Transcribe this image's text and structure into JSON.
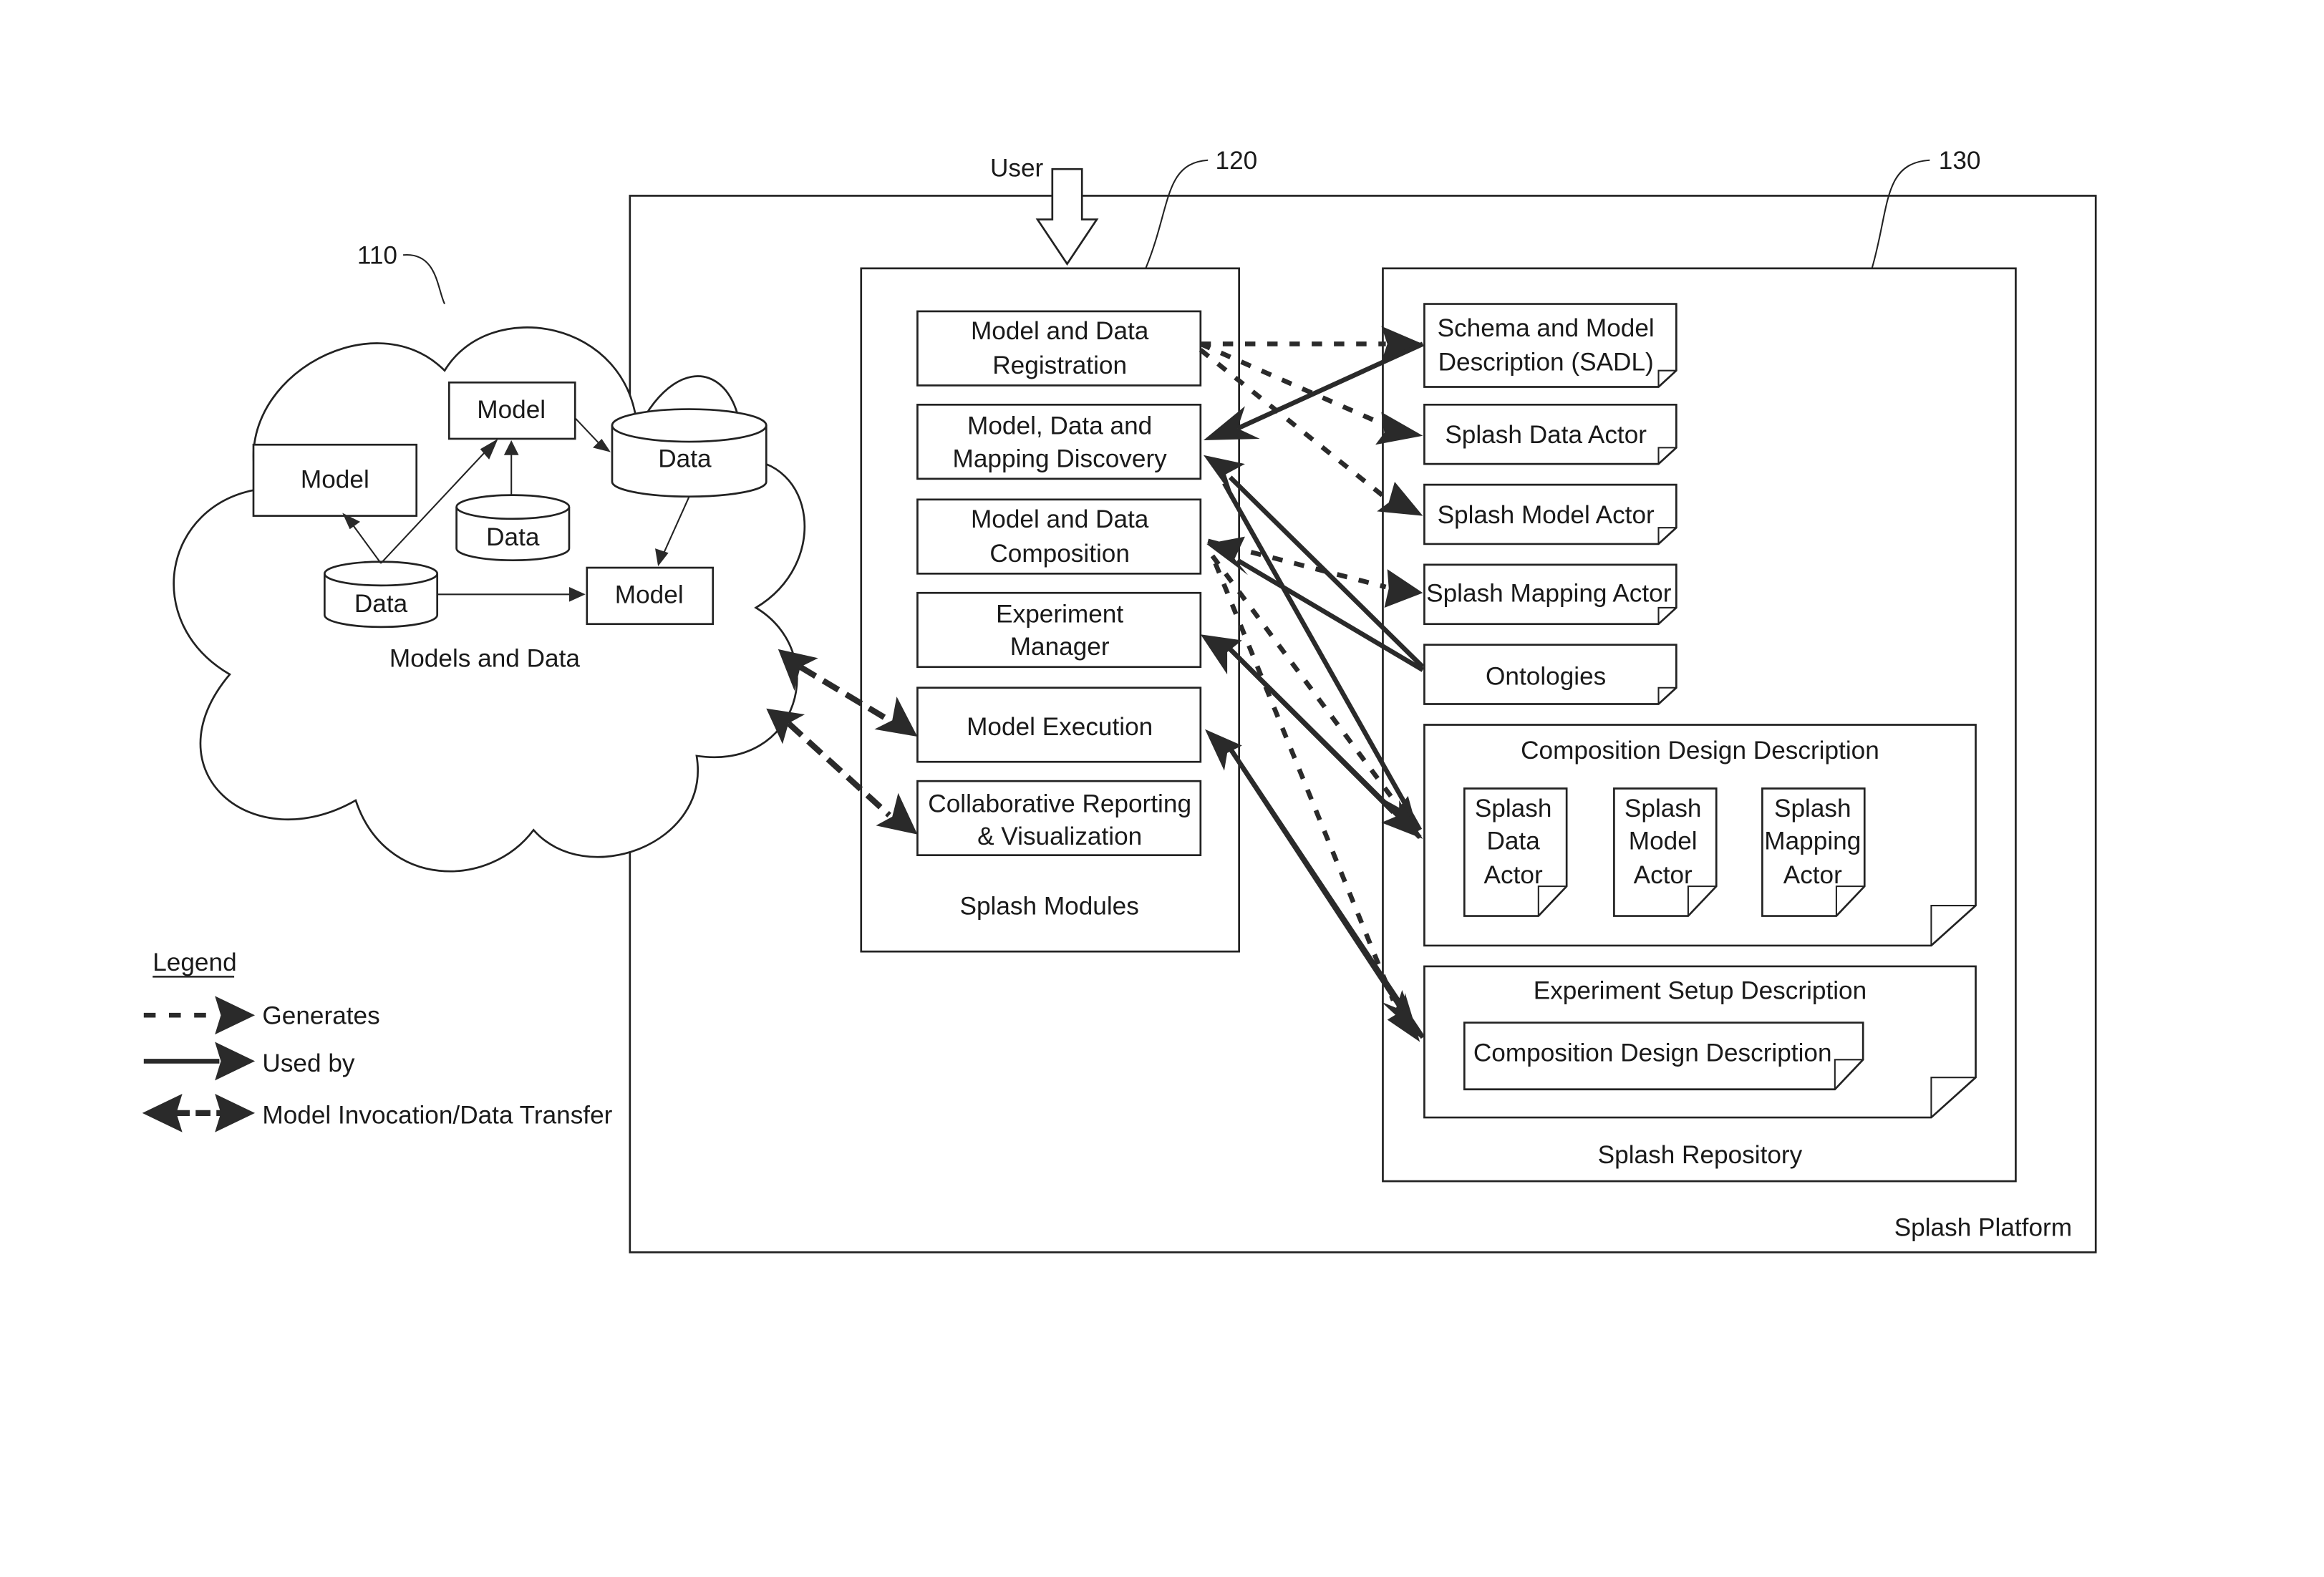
{
  "ref_labels": {
    "cloud": "110",
    "modules": "120",
    "repository": "130"
  },
  "user_label": "User",
  "cloud": {
    "title": "Models and Data",
    "nodes": [
      {
        "type": "model",
        "label": "Model"
      },
      {
        "type": "model",
        "label": "Model"
      },
      {
        "type": "data",
        "label": "Data"
      },
      {
        "type": "data",
        "label": "Data"
      },
      {
        "type": "data",
        "label": "Data"
      },
      {
        "type": "model",
        "label": "Model"
      }
    ]
  },
  "platform": {
    "title": "Splash Platform"
  },
  "modules": {
    "title": "Splash Modules",
    "items": [
      {
        "line1": "Model and Data",
        "line2": "Registration"
      },
      {
        "line1": "Model, Data and",
        "line2": "Mapping Discovery"
      },
      {
        "line1": "Model and Data",
        "line2": "Composition"
      },
      {
        "line1": "Experiment",
        "line2": "Manager"
      },
      {
        "line1": "Model Execution",
        "line2": ""
      },
      {
        "line1": "Collaborative Reporting",
        "line2": "& Visualization"
      }
    ]
  },
  "repository": {
    "title": "Splash Repository",
    "docs": [
      {
        "line1": "Schema and Model",
        "line2": "Description (SADL)"
      },
      {
        "line1": "Splash Data Actor",
        "line2": ""
      },
      {
        "line1": "Splash Model Actor",
        "line2": ""
      },
      {
        "line1": "Splash Mapping Actor",
        "line2": ""
      },
      {
        "line1": "Ontologies",
        "line2": ""
      }
    ],
    "composition": {
      "title": "Composition Design Description",
      "actors": [
        {
          "l1": "Splash",
          "l2": "Data",
          "l3": "Actor"
        },
        {
          "l1": "Splash",
          "l2": "Model",
          "l3": "Actor"
        },
        {
          "l1": "Splash",
          "l2": "Mapping",
          "l3": "Actor"
        }
      ]
    },
    "experiment": {
      "title": "Experiment Setup Description",
      "inner": "Composition Design Description"
    }
  },
  "legend": {
    "title": "Legend",
    "items": [
      {
        "style": "generates",
        "label": "Generates"
      },
      {
        "style": "used-by",
        "label": "Used by"
      },
      {
        "style": "invocation",
        "label": "Model Invocation/Data Transfer"
      }
    ]
  }
}
